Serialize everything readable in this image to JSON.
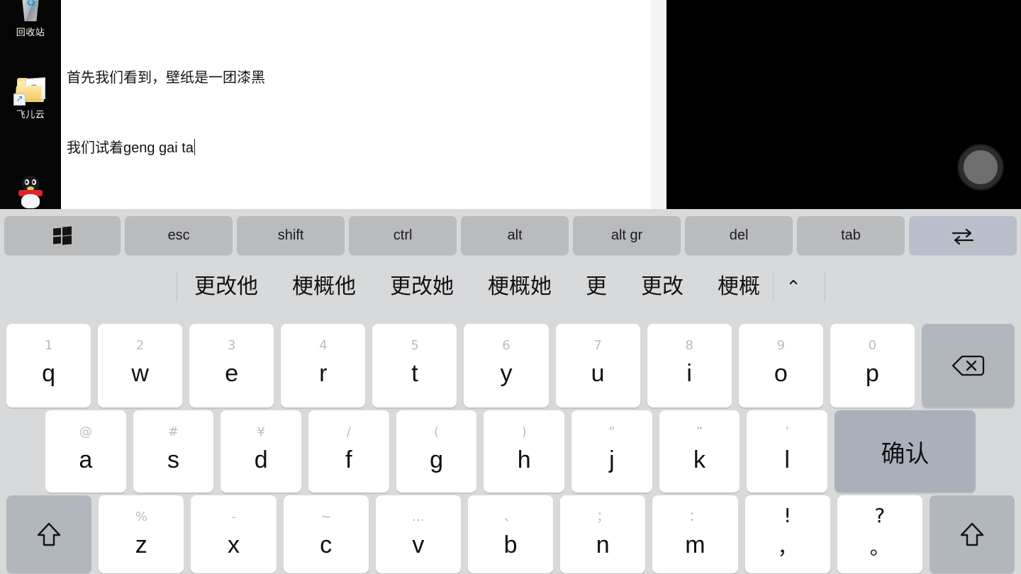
{
  "desktop": {
    "icons": [
      {
        "label": "回收站",
        "icon": "recycle-bin-icon"
      },
      {
        "label": "飞儿云",
        "icon": "folder-shortcut-icon"
      },
      {
        "label": "",
        "icon": "qq-penguin-icon"
      }
    ],
    "editor": {
      "line1": "首先我们看到，壁纸是一团漆黑",
      "line2": "我们试着geng gai ta"
    },
    "assistive_touch": {
      "icon": "assistive-touch-circle-icon"
    }
  },
  "keyboard": {
    "function_row": [
      {
        "label": "",
        "icon": "windows-logo-icon",
        "style": "normal"
      },
      {
        "label": "esc",
        "icon": "",
        "style": "normal"
      },
      {
        "label": "shift",
        "icon": "",
        "style": "normal"
      },
      {
        "label": "ctrl",
        "icon": "",
        "style": "normal"
      },
      {
        "label": "alt",
        "icon": "",
        "style": "normal"
      },
      {
        "label": "alt gr",
        "icon": "",
        "style": "normal"
      },
      {
        "label": "del",
        "icon": "",
        "style": "normal"
      },
      {
        "label": "tab",
        "icon": "",
        "style": "normal"
      },
      {
        "label": "",
        "icon": "swap-arrows-icon",
        "style": "accent"
      }
    ],
    "candidates": [
      "更改他",
      "梗概他",
      "更改她",
      "梗概她",
      "更",
      "更改",
      "梗概"
    ],
    "candidate_expand_icon": "chevron-up-icon",
    "row1": [
      {
        "sub": "1",
        "main": "q"
      },
      {
        "sub": "2",
        "main": "w"
      },
      {
        "sub": "3",
        "main": "e"
      },
      {
        "sub": "4",
        "main": "r"
      },
      {
        "sub": "5",
        "main": "t"
      },
      {
        "sub": "6",
        "main": "y"
      },
      {
        "sub": "7",
        "main": "u"
      },
      {
        "sub": "8",
        "main": "i"
      },
      {
        "sub": "9",
        "main": "o"
      },
      {
        "sub": "0",
        "main": "p"
      }
    ],
    "backspace": {
      "icon": "backspace-icon"
    },
    "row2": [
      {
        "sub": "@",
        "main": "a"
      },
      {
        "sub": "#",
        "main": "s"
      },
      {
        "sub": "¥",
        "main": "d"
      },
      {
        "sub": "/",
        "main": "f"
      },
      {
        "sub": "(",
        "main": "g"
      },
      {
        "sub": ")",
        "main": "h"
      },
      {
        "sub": "“",
        "main": "j"
      },
      {
        "sub": "”",
        "main": "k"
      },
      {
        "sub": "’",
        "main": "l"
      }
    ],
    "confirm_label": "确认",
    "row3": [
      {
        "sub": "%",
        "main": "z"
      },
      {
        "sub": "-",
        "main": "x"
      },
      {
        "sub": "~",
        "main": "c"
      },
      {
        "sub": "…",
        "main": "v"
      },
      {
        "sub": "、",
        "main": "b"
      },
      {
        "sub": "；",
        "main": "n"
      },
      {
        "sub": "：",
        "main": "m"
      }
    ],
    "row3_punct": [
      {
        "sub": "!",
        "main": "，"
      },
      {
        "sub": "?",
        "main": "。"
      }
    ],
    "shift_left_icon": "shift-arrow-icon",
    "shift_right_icon": "shift-arrow-icon"
  },
  "colors": {
    "keyboard_bg": "#d8d9db",
    "key_white": "#ffffff",
    "key_mod": "#b2b6bd",
    "fn_key": "#b9bbbd",
    "fn_key_accent": "#b8bfca",
    "sub_label": "#bcbcbe",
    "text": "#101010"
  }
}
